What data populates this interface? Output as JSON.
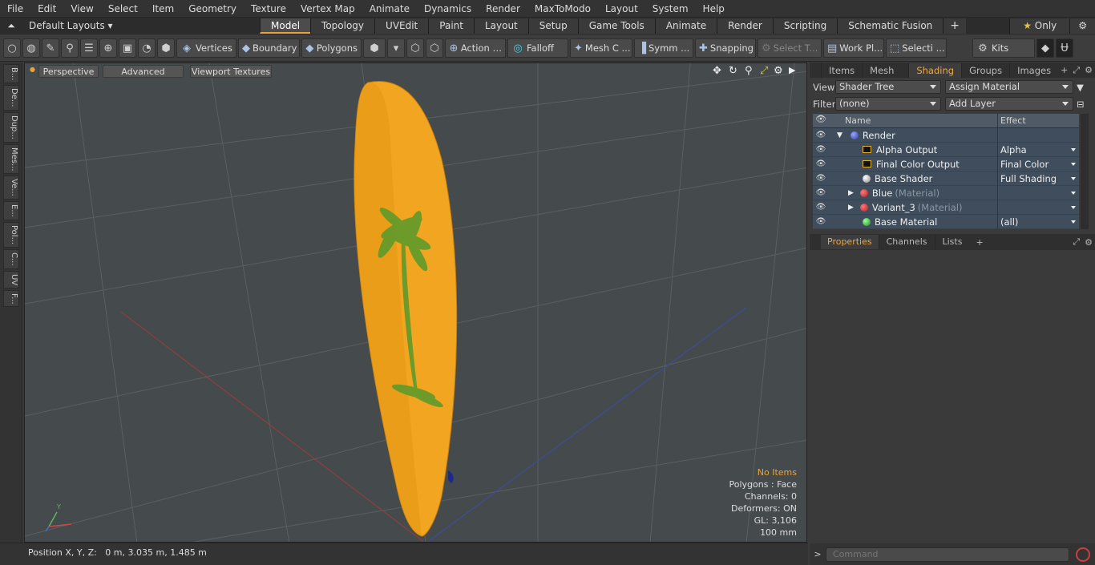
{
  "menubar": [
    "File",
    "Edit",
    "View",
    "Select",
    "Item",
    "Geometry",
    "Texture",
    "Vertex Map",
    "Animate",
    "Dynamics",
    "Render",
    "MaxToModo",
    "Layout",
    "System",
    "Help"
  ],
  "layouts_label": "Default Layouts",
  "tabs": [
    "Model",
    "Topology",
    "UVEdit",
    "Paint",
    "Layout",
    "Setup",
    "Game Tools",
    "Animate",
    "Render",
    "Scripting",
    "Schematic Fusion"
  ],
  "only_label": "Only",
  "toolbar": {
    "vertices": "Vertices",
    "boundary": "Boundary",
    "polygons": "Polygons",
    "action": "Action",
    "falloff": "Falloff",
    "mesh": "Mesh C ...",
    "symm": "Symm ...",
    "snapping": "Snapping",
    "select_t": "Select T...",
    "work_pl": "Work Pl...",
    "selecti": "Selecti ...",
    "kits": "Kits"
  },
  "left_tabs": [
    "B...",
    "De...",
    "Dup...",
    "Mes...",
    "Ve...",
    "E...",
    "Pol...",
    "C...",
    "UV",
    "F..."
  ],
  "viewport": {
    "perspective": "Perspective",
    "advanced": "Advanced",
    "textures": "Viewport Textures",
    "info": {
      "items": "No Items",
      "polygons": "Polygons : Face",
      "channels": "Channels: 0",
      "deformers": "Deformers: ON",
      "gl": "GL: 3,106",
      "scale": "100 mm"
    }
  },
  "status": "Position X, Y, Z:   0 m, 3.035 m, 1.485 m",
  "panel": {
    "tabs": [
      "Items",
      "Mesh ...",
      "Shading",
      "Groups",
      "Images"
    ],
    "view_label": "View",
    "view_value": "Shader Tree",
    "assign": "Assign Material",
    "filter_label": "Filter",
    "filter_value": "(none)",
    "add_layer": "Add Layer",
    "col_name": "Name",
    "col_effect": "Effect",
    "rows": [
      {
        "name": "Render",
        "sub": "",
        "effect": ""
      },
      {
        "name": "Alpha Output",
        "sub": "",
        "effect": "Alpha"
      },
      {
        "name": "Final Color Output",
        "sub": "",
        "effect": "Final Color"
      },
      {
        "name": "Base Shader",
        "sub": "",
        "effect": "Full Shading"
      },
      {
        "name": "Blue",
        "sub": "(Material)",
        "effect": ""
      },
      {
        "name": "Variant_3",
        "sub": "(Material)",
        "effect": ""
      },
      {
        "name": "Base Material",
        "sub": "",
        "effect": "(all)"
      }
    ],
    "prop_tabs": [
      "Properties",
      "Channels",
      "Lists"
    ],
    "command_placeholder": "Command"
  },
  "colors": {
    "accent": "#e8a33b",
    "board": "#f2a521",
    "palm": "#5f9a2a",
    "viewport_bg": "#454a4d"
  }
}
